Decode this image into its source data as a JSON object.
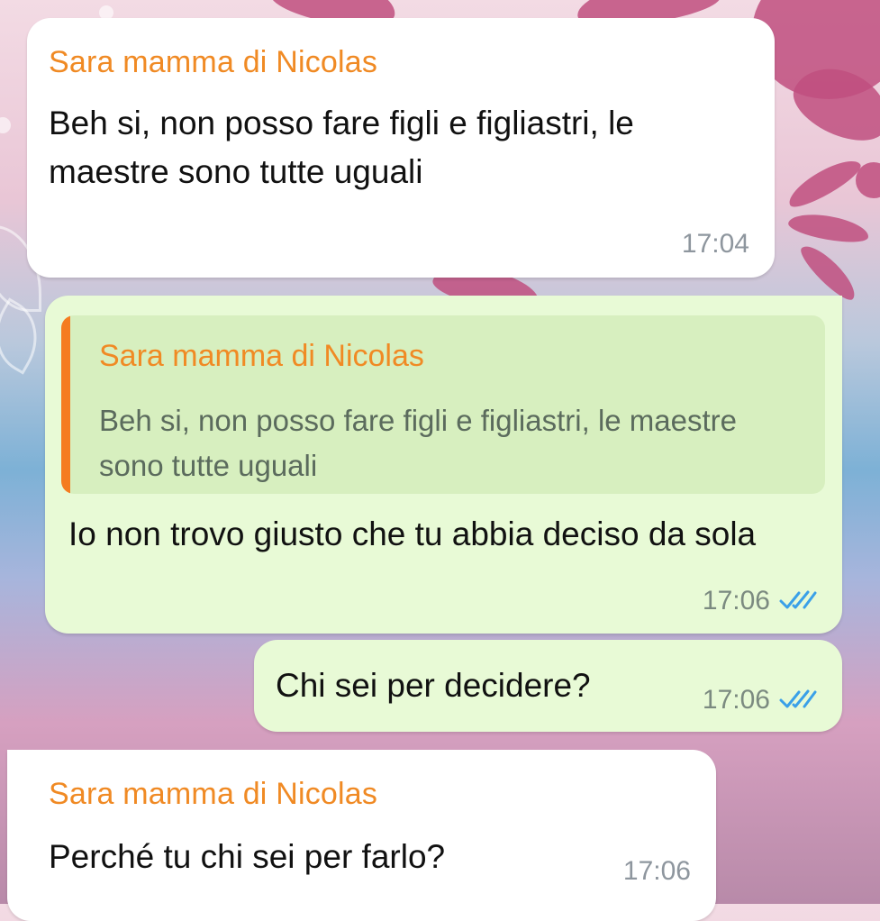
{
  "messages": [
    {
      "direction": "incoming",
      "sender": "Sara mamma di Nicolas",
      "text": "Beh si, non posso fare figli e figliastri, le maestre sono tutte uguali",
      "time": "17:04"
    },
    {
      "direction": "outgoing",
      "reply_to": {
        "sender": "Sara mamma di Nicolas",
        "text": "Beh si, non posso fare figli e figliastri, le maestre sono tutte uguali"
      },
      "text": "Io non trovo giusto che tu abbia deciso da sola",
      "time": "17:06",
      "status": "read"
    },
    {
      "direction": "outgoing",
      "text": "Chi sei per decidere?",
      "time": "17:06",
      "status": "read"
    },
    {
      "direction": "incoming",
      "sender": "Sara mamma di Nicolas",
      "text": "Perché tu chi sei per farlo?",
      "time": "17:06"
    }
  ],
  "colors": {
    "sender_name": "#f08a24",
    "outgoing_bubble": "#e8fad6",
    "incoming_bubble": "#ffffff",
    "read_ticks": "#3aa0e8",
    "wallpaper_flowers": "#c04f7f"
  },
  "icons": {
    "read_receipt": "double-check-icon"
  }
}
